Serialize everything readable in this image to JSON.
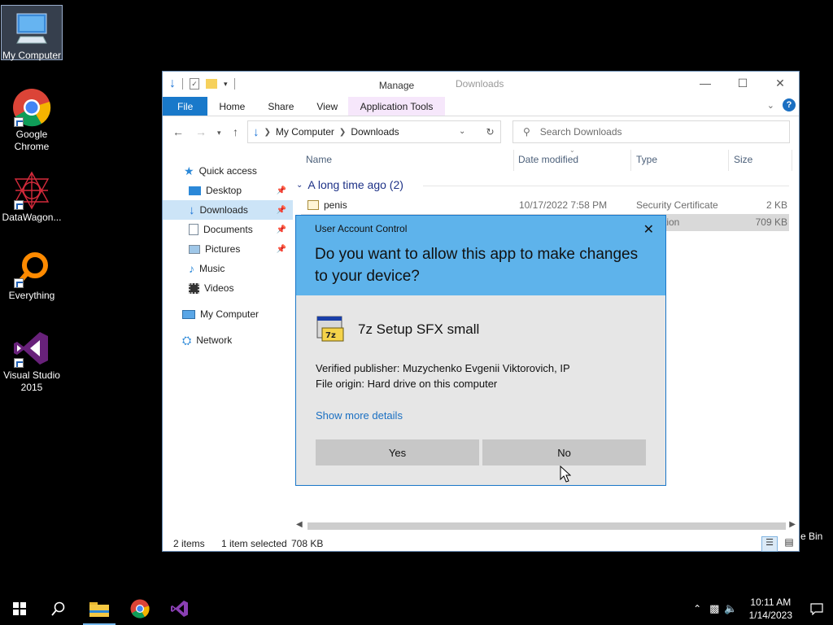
{
  "desktop": {
    "icons": [
      {
        "label": "My Computer",
        "icon": "computer-icon"
      },
      {
        "label": "Google Chrome",
        "icon": "chrome-icon"
      },
      {
        "label": "DataWagon...",
        "icon": "datawagon-icon"
      },
      {
        "label": "Everything",
        "icon": "everything-icon"
      },
      {
        "label": "Visual Studio 2015",
        "icon": "visual-studio-icon"
      }
    ],
    "recycle_bin_label": "e Bin"
  },
  "explorer": {
    "title": "Downloads",
    "contextual_tab_group": "Manage",
    "ribbon_tabs": [
      "File",
      "Home",
      "Share",
      "View",
      "Application Tools"
    ],
    "address": {
      "segments": [
        "My Computer",
        "Downloads"
      ]
    },
    "search_placeholder": "Search Downloads",
    "nav_pane": [
      {
        "label": "Quick access",
        "icon": "star-icon",
        "pinned": false
      },
      {
        "label": "Desktop",
        "icon": "desktop-icon",
        "pinned": true
      },
      {
        "label": "Downloads",
        "icon": "download-icon",
        "pinned": true,
        "selected": true
      },
      {
        "label": "Documents",
        "icon": "documents-icon",
        "pinned": true
      },
      {
        "label": "Pictures",
        "icon": "pictures-icon",
        "pinned": true
      },
      {
        "label": "Music",
        "icon": "music-icon",
        "pinned": false
      },
      {
        "label": "Videos",
        "icon": "videos-icon",
        "pinned": false
      },
      {
        "label": "My Computer",
        "icon": "computer-icon",
        "pinned": false
      },
      {
        "label": "Network",
        "icon": "network-icon",
        "pinned": false
      }
    ],
    "columns": [
      "Name",
      "Date modified",
      "Type",
      "Size"
    ],
    "group": "A long time ago (2)",
    "rows": [
      {
        "name": "penis",
        "date": "10/17/2022 7:58 PM",
        "type": "Security Certificate",
        "size": "2 KB"
      },
      {
        "name": "",
        "date": "",
        "type": "tion",
        "size": "709 KB",
        "selected": true
      }
    ],
    "status": {
      "items": "2 items",
      "selected": "1 item selected",
      "size": "708 KB"
    }
  },
  "uac": {
    "title": "User Account Control",
    "question": "Do you want to allow this app to make changes to your device?",
    "app_name": "7z Setup SFX small",
    "publisher": "Verified publisher: Muzychenko Evgenii Viktorovich, IP",
    "origin": "File origin: Hard drive on this computer",
    "details_link": "Show more details",
    "yes_label": "Yes",
    "no_label": "No"
  },
  "taskbar": {
    "time": "10:11 AM",
    "date": "1/14/2023"
  },
  "colors": {
    "uac_header": "#5eb3eb",
    "file_tab": "#1979ca",
    "manage_tab": "#f1d8f9",
    "selection": "#cce4f7",
    "link": "#1a6fc2"
  }
}
